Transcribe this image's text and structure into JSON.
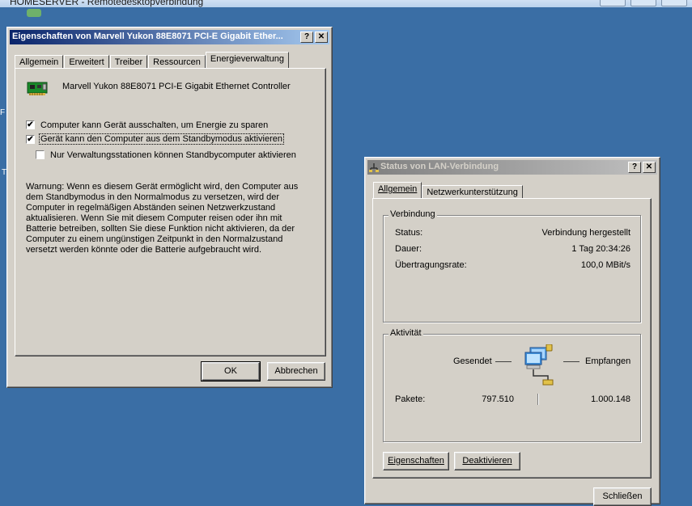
{
  "rdp": {
    "title": "HOMESERVER - Remotedesktopverbindung"
  },
  "desktop": {
    "frag1": "F",
    "frag2": "T"
  },
  "props": {
    "title": "Eigenschaften von Marvell Yukon 88E8071 PCI-E Gigabit Ether...",
    "tabs": [
      "Allgemein",
      "Erweitert",
      "Treiber",
      "Ressourcen",
      "Energieverwaltung"
    ],
    "device_name": "Marvell Yukon 88E8071 PCI-E Gigabit Ethernet Controller",
    "option1": "Computer kann Gerät ausschalten, um Energie zu sparen",
    "option2": "Gerät kann den Computer aus dem Standbymodus aktivieren",
    "option3": "Nur Verwaltungsstationen können Standbycomputer aktivieren",
    "option1_checked": true,
    "option2_checked": true,
    "option3_checked": false,
    "warning": "Warnung: Wenn es diesem Gerät ermöglicht wird, den Computer aus dem Standbymodus in den Normalmodus zu versetzen, wird der Computer in regelmäßigen Abständen seinen Netzwerkzustand aktualisieren. Wenn Sie mit diesem Computer reisen oder ihn mit Batterie betreiben, sollten Sie diese Funktion nicht aktivieren, da der Computer zu einem ungünstigen Zeitpunkt in den Normalzustand versetzt werden könnte oder die Batterie aufgebraucht wird.",
    "ok": "OK",
    "cancel": "Abbrechen",
    "help_glyph": "?",
    "close_glyph": "✕"
  },
  "status": {
    "title": "Status von LAN-Verbindung",
    "tabs": [
      "Allgemein",
      "Netzwerkunterstützung"
    ],
    "connection_group": "Verbindung",
    "status_label": "Status:",
    "status_value": "Verbindung hergestellt",
    "duration_label": "Dauer:",
    "duration_value": "1 Tag 20:34:26",
    "speed_label": "Übertragungsrate:",
    "speed_value": "100,0 MBit/s",
    "activity_group": "Aktivität",
    "sent_label": "Gesendet",
    "received_label": "Empfangen",
    "packets_label": "Pakete:",
    "packets_sent": "797.510",
    "packets_received": "1.000.148",
    "properties_button": "Eigenschaften",
    "disable_button": "Deaktivieren",
    "close_button": "Schließen",
    "help_glyph": "?",
    "close_glyph": "✕"
  }
}
